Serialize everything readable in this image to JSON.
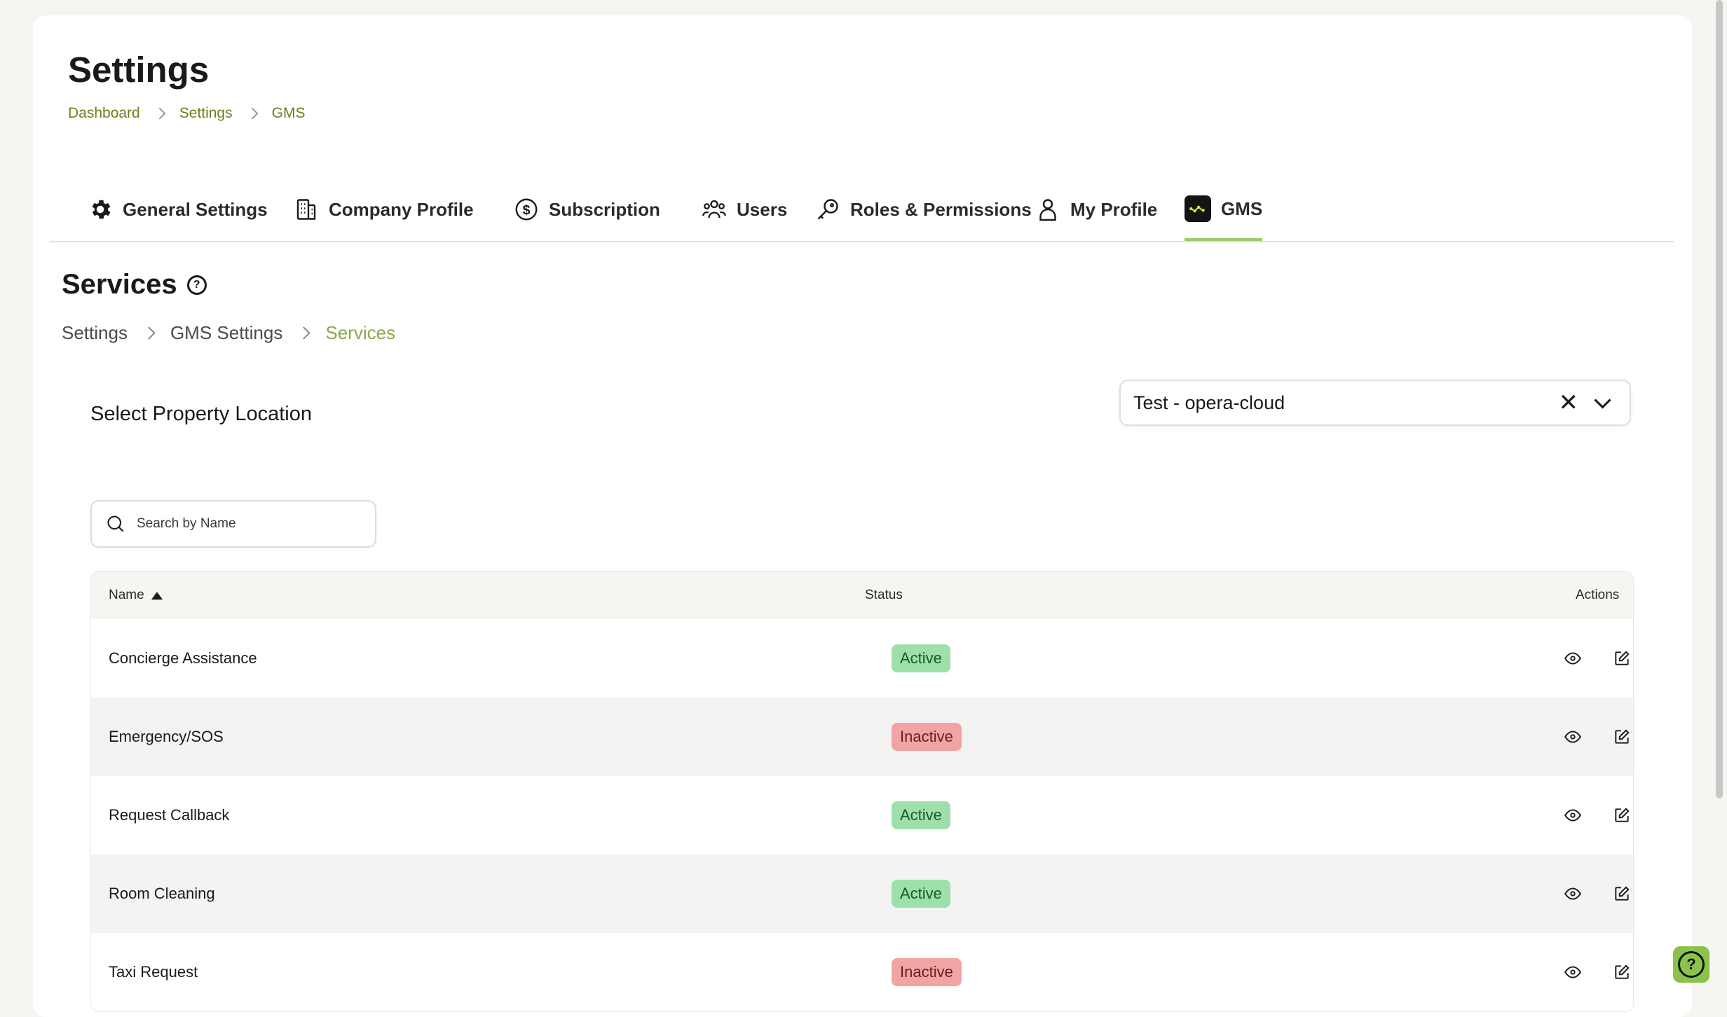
{
  "page": {
    "title": "Settings",
    "breadcrumb": [
      "Dashboard",
      "Settings",
      "GMS"
    ]
  },
  "tabs": [
    {
      "label": "General Settings",
      "icon": "gear-icon"
    },
    {
      "label": "Company Profile",
      "icon": "building-icon"
    },
    {
      "label": "Subscription",
      "icon": "dollar-circle-icon"
    },
    {
      "label": "Users",
      "icon": "users-icon"
    },
    {
      "label": "Roles & Permissions",
      "icon": "key-icon"
    },
    {
      "label": "My Profile",
      "icon": "person-icon"
    },
    {
      "label": "GMS",
      "icon": "gms-logo-icon",
      "active": true
    }
  ],
  "section": {
    "title": "Services",
    "breadcrumb": [
      "Settings",
      "GMS Settings",
      "Services"
    ]
  },
  "location": {
    "label": "Select Property Location",
    "selected": "Test - opera-cloud"
  },
  "search": {
    "placeholder": "Search by Name"
  },
  "table": {
    "columns": [
      "Name",
      "Status",
      "Actions"
    ],
    "rows": [
      {
        "name": "Concierge Assistance",
        "status": "Active"
      },
      {
        "name": "Emergency/SOS",
        "status": "Inactive"
      },
      {
        "name": "Request Callback",
        "status": "Active"
      },
      {
        "name": "Room Cleaning",
        "status": "Active"
      },
      {
        "name": "Taxi Request",
        "status": "Inactive"
      }
    ]
  },
  "colors": {
    "accent": "#9ccc65",
    "breadcrumb_link": "#6b7f1e",
    "active_badge": "#9de0ac",
    "inactive_badge": "#f0a4a4"
  }
}
